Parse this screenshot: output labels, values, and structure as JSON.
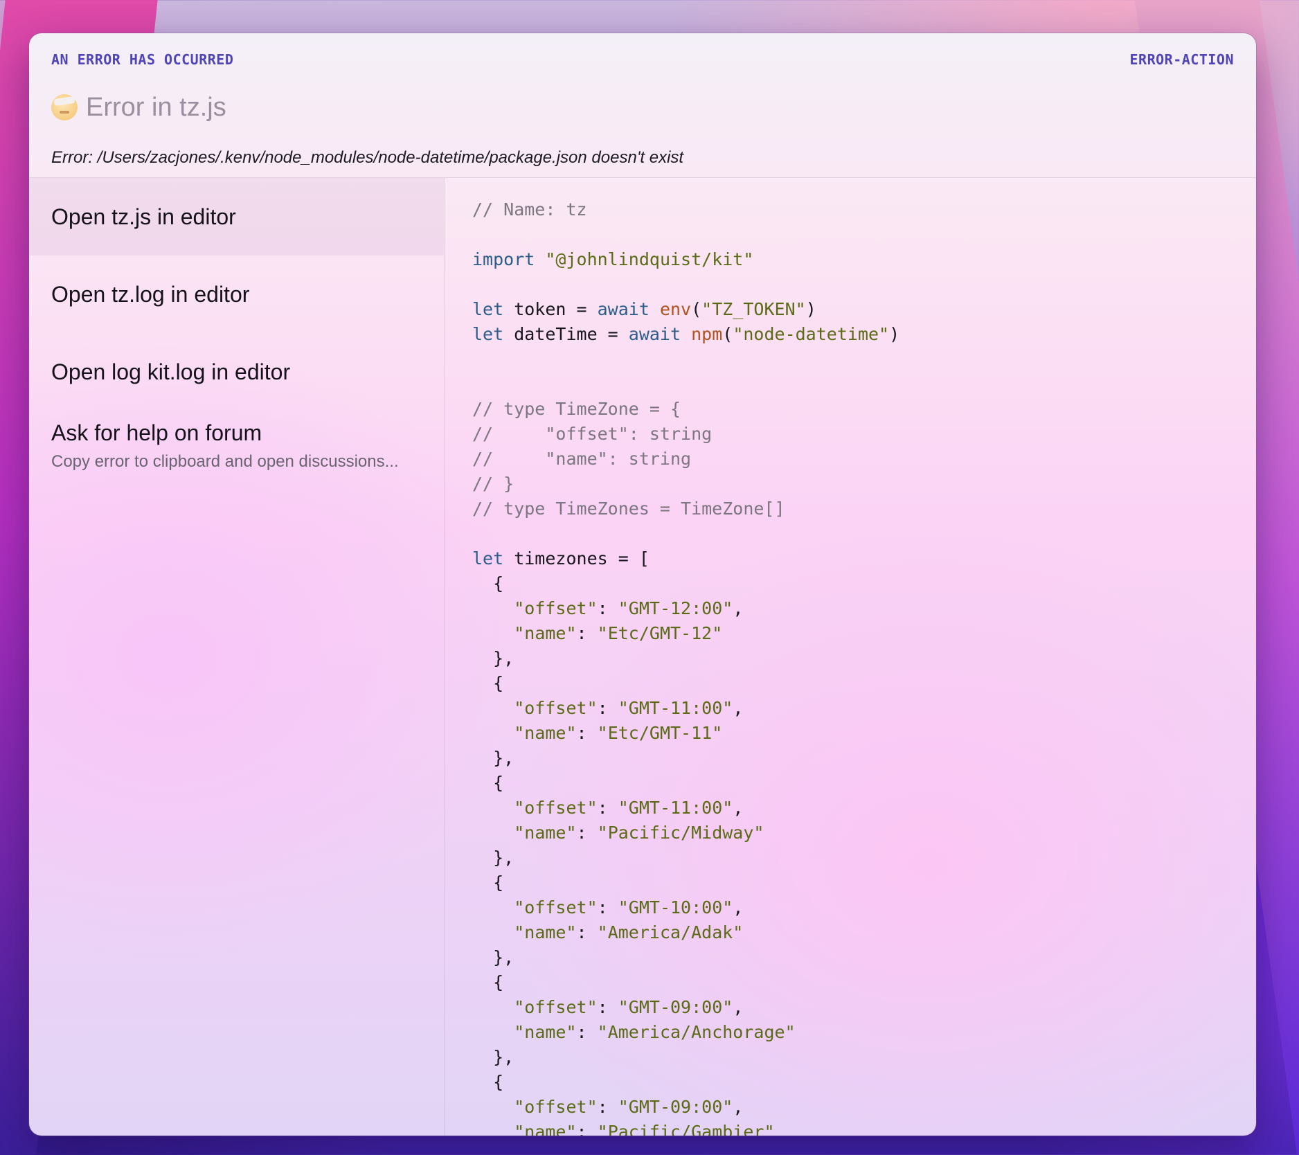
{
  "header": {
    "label_left": "AN ERROR HAS OCCURRED",
    "label_right": "ERROR-ACTION",
    "title_icon": "bandaged-face-emoji-icon",
    "title": "Error in tz.js",
    "error_message": "Error: /Users/zacjones/.kenv/node_modules/node-datetime/package.json doesn't exist"
  },
  "choices": [
    {
      "label": "Open tz.js in editor",
      "description": "",
      "active": true
    },
    {
      "label": "Open tz.log in editor",
      "description": "",
      "active": false
    },
    {
      "label": "Open log kit.log in editor",
      "description": "",
      "active": false
    },
    {
      "label": "Ask for help on forum",
      "description": "Copy error to clipboard and open discussions...",
      "active": false
    }
  ],
  "code_lines": [
    [
      {
        "t": "// Name: tz",
        "k": "comment"
      }
    ],
    [],
    [
      {
        "t": "import",
        "k": "keyword"
      },
      {
        "t": " ",
        "k": "plain"
      },
      {
        "t": "\"@johnlindquist/kit\"",
        "k": "string"
      }
    ],
    [],
    [
      {
        "t": "let",
        "k": "keyword"
      },
      {
        "t": " token = ",
        "k": "plain"
      },
      {
        "t": "await",
        "k": "keyword"
      },
      {
        "t": " ",
        "k": "plain"
      },
      {
        "t": "env",
        "k": "func"
      },
      {
        "t": "(",
        "k": "plain"
      },
      {
        "t": "\"TZ_TOKEN\"",
        "k": "string"
      },
      {
        "t": ")",
        "k": "plain"
      }
    ],
    [
      {
        "t": "let",
        "k": "keyword"
      },
      {
        "t": " dateTime = ",
        "k": "plain"
      },
      {
        "t": "await",
        "k": "keyword"
      },
      {
        "t": " ",
        "k": "plain"
      },
      {
        "t": "npm",
        "k": "func"
      },
      {
        "t": "(",
        "k": "plain"
      },
      {
        "t": "\"node-datetime\"",
        "k": "string"
      },
      {
        "t": ")",
        "k": "plain"
      }
    ],
    [],
    [],
    [
      {
        "t": "// type TimeZone = {",
        "k": "comment"
      }
    ],
    [
      {
        "t": "//     \"offset\": string",
        "k": "comment"
      }
    ],
    [
      {
        "t": "//     \"name\": string",
        "k": "comment"
      }
    ],
    [
      {
        "t": "// }",
        "k": "comment"
      }
    ],
    [
      {
        "t": "// type TimeZones = TimeZone[]",
        "k": "comment"
      }
    ],
    [],
    [
      {
        "t": "let",
        "k": "keyword"
      },
      {
        "t": " timezones = [",
        "k": "plain"
      }
    ],
    [
      {
        "t": "  {",
        "k": "plain"
      }
    ],
    [
      {
        "t": "    ",
        "k": "plain"
      },
      {
        "t": "\"offset\"",
        "k": "string"
      },
      {
        "t": ": ",
        "k": "plain"
      },
      {
        "t": "\"GMT-12:00\"",
        "k": "string"
      },
      {
        "t": ",",
        "k": "plain"
      }
    ],
    [
      {
        "t": "    ",
        "k": "plain"
      },
      {
        "t": "\"name\"",
        "k": "string"
      },
      {
        "t": ": ",
        "k": "plain"
      },
      {
        "t": "\"Etc/GMT-12\"",
        "k": "string"
      }
    ],
    [
      {
        "t": "  },",
        "k": "plain"
      }
    ],
    [
      {
        "t": "  {",
        "k": "plain"
      }
    ],
    [
      {
        "t": "    ",
        "k": "plain"
      },
      {
        "t": "\"offset\"",
        "k": "string"
      },
      {
        "t": ": ",
        "k": "plain"
      },
      {
        "t": "\"GMT-11:00\"",
        "k": "string"
      },
      {
        "t": ",",
        "k": "plain"
      }
    ],
    [
      {
        "t": "    ",
        "k": "plain"
      },
      {
        "t": "\"name\"",
        "k": "string"
      },
      {
        "t": ": ",
        "k": "plain"
      },
      {
        "t": "\"Etc/GMT-11\"",
        "k": "string"
      }
    ],
    [
      {
        "t": "  },",
        "k": "plain"
      }
    ],
    [
      {
        "t": "  {",
        "k": "plain"
      }
    ],
    [
      {
        "t": "    ",
        "k": "plain"
      },
      {
        "t": "\"offset\"",
        "k": "string"
      },
      {
        "t": ": ",
        "k": "plain"
      },
      {
        "t": "\"GMT-11:00\"",
        "k": "string"
      },
      {
        "t": ",",
        "k": "plain"
      }
    ],
    [
      {
        "t": "    ",
        "k": "plain"
      },
      {
        "t": "\"name\"",
        "k": "string"
      },
      {
        "t": ": ",
        "k": "plain"
      },
      {
        "t": "\"Pacific/Midway\"",
        "k": "string"
      }
    ],
    [
      {
        "t": "  },",
        "k": "plain"
      }
    ],
    [
      {
        "t": "  {",
        "k": "plain"
      }
    ],
    [
      {
        "t": "    ",
        "k": "plain"
      },
      {
        "t": "\"offset\"",
        "k": "string"
      },
      {
        "t": ": ",
        "k": "plain"
      },
      {
        "t": "\"GMT-10:00\"",
        "k": "string"
      },
      {
        "t": ",",
        "k": "plain"
      }
    ],
    [
      {
        "t": "    ",
        "k": "plain"
      },
      {
        "t": "\"name\"",
        "k": "string"
      },
      {
        "t": ": ",
        "k": "plain"
      },
      {
        "t": "\"America/Adak\"",
        "k": "string"
      }
    ],
    [
      {
        "t": "  },",
        "k": "plain"
      }
    ],
    [
      {
        "t": "  {",
        "k": "plain"
      }
    ],
    [
      {
        "t": "    ",
        "k": "plain"
      },
      {
        "t": "\"offset\"",
        "k": "string"
      },
      {
        "t": ": ",
        "k": "plain"
      },
      {
        "t": "\"GMT-09:00\"",
        "k": "string"
      },
      {
        "t": ",",
        "k": "plain"
      }
    ],
    [
      {
        "t": "    ",
        "k": "plain"
      },
      {
        "t": "\"name\"",
        "k": "string"
      },
      {
        "t": ": ",
        "k": "plain"
      },
      {
        "t": "\"America/Anchorage\"",
        "k": "string"
      }
    ],
    [
      {
        "t": "  },",
        "k": "plain"
      }
    ],
    [
      {
        "t": "  {",
        "k": "plain"
      }
    ],
    [
      {
        "t": "    ",
        "k": "plain"
      },
      {
        "t": "\"offset\"",
        "k": "string"
      },
      {
        "t": ": ",
        "k": "plain"
      },
      {
        "t": "\"GMT-09:00\"",
        "k": "string"
      },
      {
        "t": ",",
        "k": "plain"
      }
    ],
    [
      {
        "t": "    ",
        "k": "plain"
      },
      {
        "t": "\"name\"",
        "k": "string"
      },
      {
        "t": ": ",
        "k": "plain"
      },
      {
        "t": "\"Pacific/Gambier\"",
        "k": "string"
      }
    ]
  ]
}
